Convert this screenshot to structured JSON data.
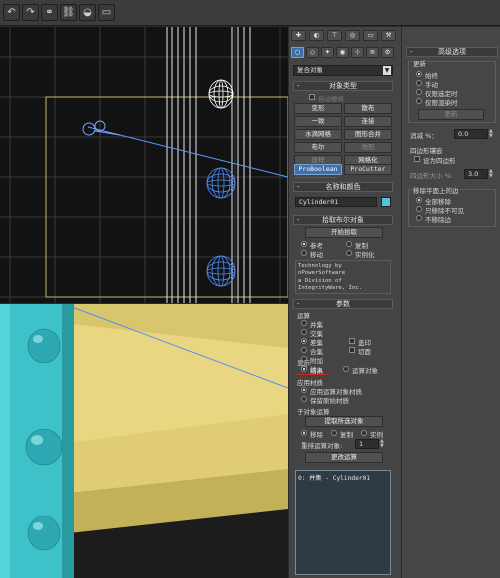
{
  "toolbar": {
    "buttons": [
      "undo-icon",
      "redo-icon",
      "select-link-icon",
      "unlink-icon",
      "bind-warp-icon",
      "layers-icon"
    ]
  },
  "panel_tabs": [
    "create-icon",
    "modify-icon",
    "hierarchy-icon",
    "motion-icon",
    "display-icon",
    "utilities-icon"
  ],
  "category_icons": [
    "geometry-icon",
    "shapes-icon",
    "lights-icon",
    "cameras-icon",
    "helpers-icon",
    "spacewarps-icon",
    "systems-icon"
  ],
  "object_category": "复合对象",
  "object_type": {
    "title": "对象类型",
    "autogrid_label": "自动栅格",
    "buttons": [
      "变形",
      "散布",
      "一致",
      "连接",
      "水滴网格",
      "图形合并",
      "布尔",
      "地形",
      "放样",
      "网格化",
      "ProBoolean",
      "ProCutter"
    ]
  },
  "name_color": {
    "title": "名称和颜色",
    "name": "Cylinder01",
    "color": "#4fc3e8"
  },
  "pick_boolean": {
    "title": "拾取布尔对象",
    "start_pick": "开始拾取",
    "options": [
      "参考",
      "复制",
      "移动",
      "实例化"
    ],
    "credits": [
      "Technology by",
      "nPowerSoftware",
      "a Division of",
      "IntegrityWare, Inc."
    ]
  },
  "params": {
    "title": "参数",
    "ops_label": "运算",
    "ops": [
      "并集",
      "交集",
      "差集",
      "合集",
      "附加",
      "插入",
      "盖印",
      "切面"
    ],
    "display_label": "显示",
    "display": [
      "结果",
      "运算对象"
    ],
    "materials_label": "应用材质",
    "materials": [
      "应用运算对象材质",
      "保留原始材质"
    ],
    "sub_label": "子对象运算",
    "extract_btn": "提取所选对象",
    "sub_ops": [
      "移除",
      "复制",
      "实例"
    ],
    "reorder_label": "重排运算对象:",
    "reorder_value": "1",
    "change_btn": "更改运算",
    "list_items": [
      "0: 并集 - Cylinder01"
    ]
  },
  "advanced": {
    "title": "高级选项",
    "update_label": "更新",
    "update_opts": [
      "始终",
      "手动",
      "仅限选定时",
      "仅限渲染时"
    ],
    "update_btn": "更新",
    "decimate_label": "消减 %：",
    "decimate_value": "0.0",
    "quad_label": "四边形镶嵌",
    "quad_check": "设为四边形",
    "quad_size_label": "四边形大小 %:",
    "quad_size_value": "3.0",
    "planar_label": "移除平面上的边",
    "planar_opts": [
      "全部移除",
      "只移除不可见",
      "不移除边"
    ]
  }
}
